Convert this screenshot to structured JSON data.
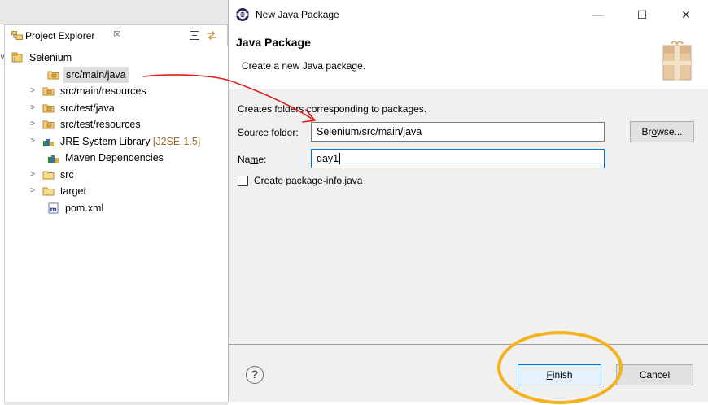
{
  "explorer": {
    "tab_title": "Project Explorer",
    "tab_close": "☒",
    "tree": [
      {
        "label": "Selenium",
        "suffix": "",
        "arrow": "∨",
        "icon": "project-icon"
      },
      {
        "label": "src/main/java",
        "suffix": "",
        "arrow": "",
        "icon": "package-folder-icon",
        "selected": true
      },
      {
        "label": "src/main/resources",
        "suffix": "",
        "arrow": ">",
        "icon": "package-folder-icon"
      },
      {
        "label": "src/test/java",
        "suffix": "",
        "arrow": ">",
        "icon": "package-folder-icon"
      },
      {
        "label": "src/test/resources",
        "suffix": "",
        "arrow": ">",
        "icon": "package-folder-icon"
      },
      {
        "label": "JRE System Library ",
        "suffix": "[J2SE-1.5]",
        "arrow": ">",
        "icon": "library-icon"
      },
      {
        "label": "Maven Dependencies",
        "suffix": "",
        "arrow": "",
        "icon": "library-icon"
      },
      {
        "label": "src",
        "suffix": "",
        "arrow": ">",
        "icon": "folder-icon"
      },
      {
        "label": "target",
        "suffix": "",
        "arrow": ">",
        "icon": "folder-icon"
      },
      {
        "label": "pom.xml",
        "suffix": "",
        "arrow": "",
        "icon": "maven-file-icon"
      }
    ]
  },
  "dialog": {
    "window_title": "New Java Package",
    "minimize": "—",
    "maximize": "☐",
    "close": "✕",
    "page_title": "Java Package",
    "page_description": "Create a new Java package.",
    "description": "Creates folders corresponding to packages.",
    "source_folder": {
      "label_before": "Source fol",
      "label_mnemonic": "d",
      "label_after": "er:",
      "value": "Selenium/src/main/java"
    },
    "browse_label_before": "Br",
    "browse_label_mnemonic": "o",
    "browse_label_after": "wse...",
    "name": {
      "label_before": "Na",
      "label_mnemonic": "m",
      "label_after": "e:",
      "value": "day1"
    },
    "create_info": {
      "mnemonic": "C",
      "rest": "reate package-info.java",
      "checked": false
    },
    "help": "?",
    "finish_mnemonic": "F",
    "finish_rest": "inish",
    "cancel_label": "Cancel"
  },
  "colors": {
    "annotation_arrow": "#e0201a",
    "highlight_ring": "#f3b21d",
    "focus_border": "#0078d7"
  }
}
